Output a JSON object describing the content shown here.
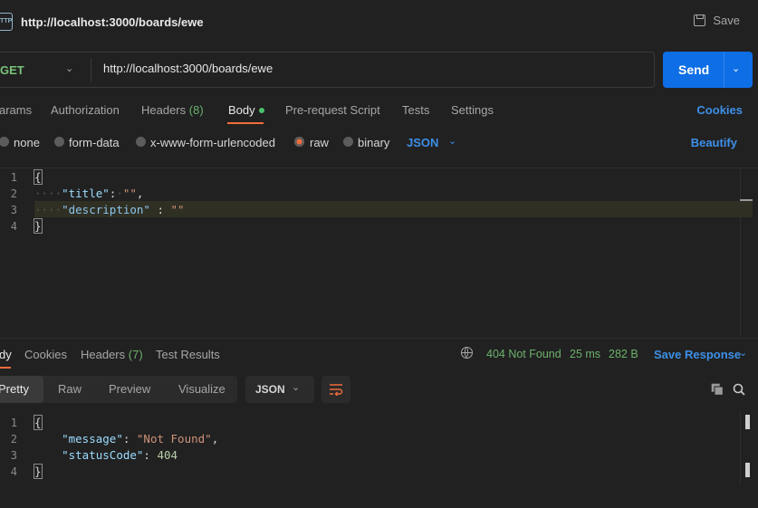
{
  "titlebar": {
    "icon": "http-icon",
    "icon_text": "HTTP",
    "title": "http://localhost:3000/boards/ewe",
    "save_label": "Save"
  },
  "request": {
    "method": "GET",
    "url": "http://localhost:3000/boards/ewe",
    "send_label": "Send"
  },
  "request_tabs": {
    "params": "arams",
    "authorization": "Authorization",
    "headers": "Headers",
    "headers_count": "(8)",
    "body": "Body",
    "pre_request": "Pre-request Script",
    "tests": "Tests",
    "settings": "Settings",
    "cookies": "Cookies"
  },
  "body_types": {
    "none": "none",
    "form_data": "form-data",
    "urlencoded": "x-www-form-urlencoded",
    "raw": "raw",
    "binary": "binary",
    "selected": "raw",
    "language": "JSON",
    "beautify": "Beautify"
  },
  "request_body": {
    "line_numbers": [
      "1",
      "2",
      "3",
      "4"
    ],
    "open_brace": "{",
    "key1": "\"title\"",
    "colon1": ":",
    "val1": "\"\"",
    "comma1": ",",
    "key2": "\"description\"",
    "colon2": " : ",
    "val2": "\"\"",
    "close_brace": "}"
  },
  "response_tabs": {
    "body": "dy",
    "cookies": "Cookies",
    "headers": "Headers",
    "headers_count": "(7)",
    "test_results": "Test Results"
  },
  "response_status": {
    "status": "404 Not Found",
    "time": "25 ms",
    "size": "282 B",
    "save_response": "Save Response"
  },
  "response_view": {
    "pretty": "Pretty",
    "raw": "Raw",
    "preview": "Preview",
    "visualize": "Visualize",
    "format": "JSON"
  },
  "response_body": {
    "line_numbers": [
      "1",
      "2",
      "3",
      "4"
    ],
    "open_brace": "{",
    "key1": "\"message\"",
    "val1": "\"Not Found\"",
    "key2": "\"statusCode\"",
    "val2": "404",
    "close_brace": "}"
  },
  "colors": {
    "background": "#212121",
    "accent_blue": "#0e6ee6",
    "link_blue": "#3d8fe8",
    "active_orange": "#f26b3a",
    "status_green": "#6bb16b"
  }
}
